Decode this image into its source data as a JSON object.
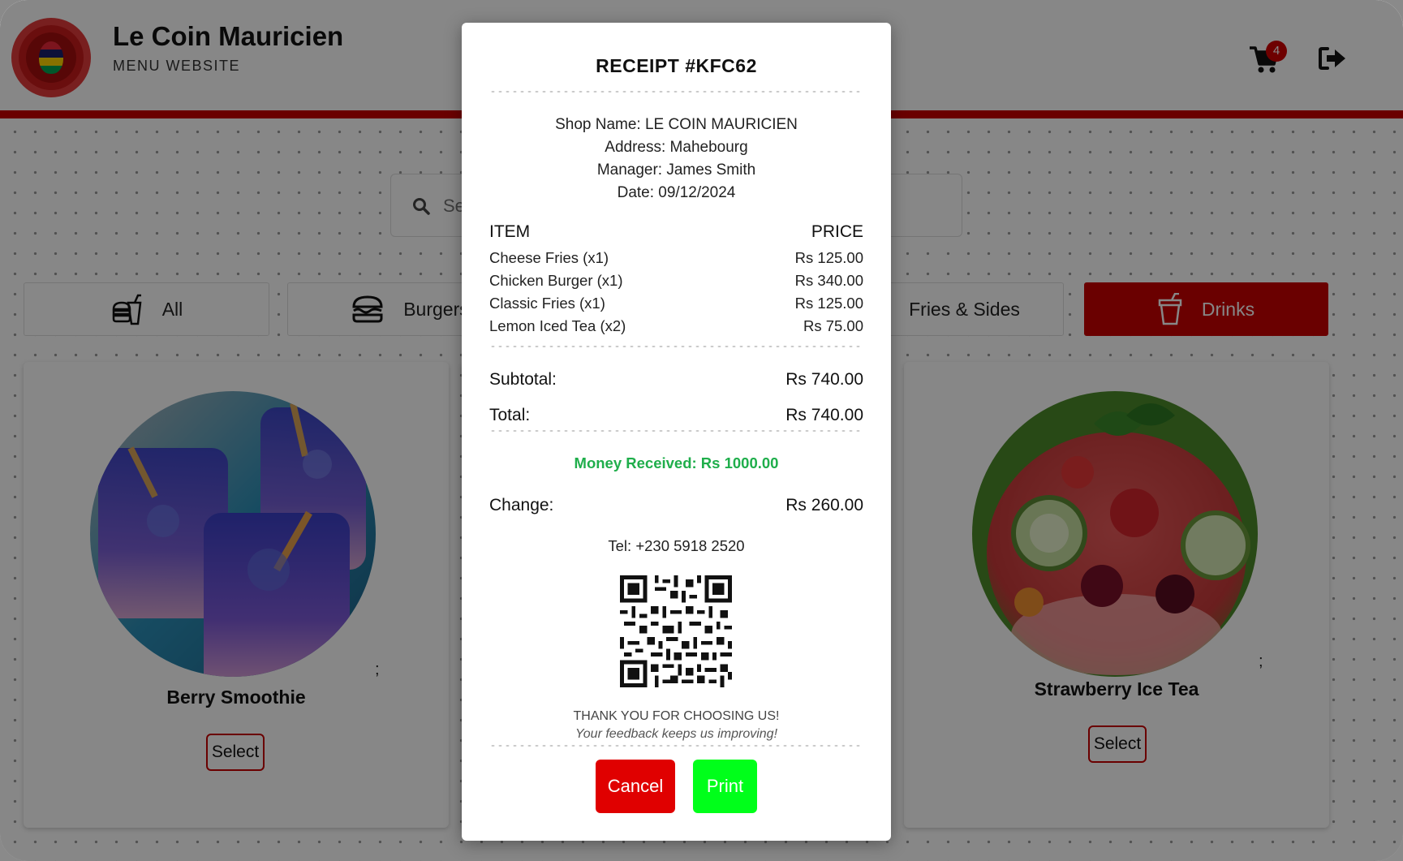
{
  "header": {
    "title": "Le Coin Mauricien",
    "subtitle": "MENU WEBSITE",
    "cart_count": "4"
  },
  "search": {
    "placeholder": "Search..."
  },
  "categories": [
    {
      "label": "All",
      "icon": "fast-food-icon",
      "active": false
    },
    {
      "label": "Burgers",
      "icon": "burger-icon",
      "active": false
    },
    {
      "label": "Fries & Sides",
      "icon": "fries-icon",
      "active": false
    },
    {
      "label": "Drinks",
      "icon": "drink-cup-icon",
      "active": true
    }
  ],
  "products": [
    {
      "name": "Berry Smoothie",
      "note": ";",
      "button": "Select"
    },
    {
      "name": "Strawberry Ice Tea",
      "note": ";",
      "button": "Select"
    }
  ],
  "receipt": {
    "title": "RECEIPT #KFC62",
    "shop_name": "Shop Name: LE COIN MAURICIEN",
    "address": "Address: Mahebourg",
    "manager": "Manager: James Smith",
    "date": "Date: 09/12/2024",
    "col_item": "ITEM",
    "col_price": "PRICE",
    "items": [
      {
        "name": "Cheese Fries (x1)",
        "price": "Rs 125.00"
      },
      {
        "name": "Chicken Burger (x1)",
        "price": "Rs 340.00"
      },
      {
        "name": "Classic Fries (x1)",
        "price": "Rs 125.00"
      },
      {
        "name": "Lemon Iced Tea (x2)",
        "price": "Rs 75.00"
      }
    ],
    "subtotal_label": "Subtotal:",
    "subtotal_value": "Rs 740.00",
    "total_label": "Total:",
    "total_value": "Rs 740.00",
    "money_received": "Money Received: Rs 1000.00",
    "change_label": "Change:",
    "change_value": "Rs 260.00",
    "tel": "Tel: +230 5918 2520",
    "thanks": "THANK YOU FOR CHOOSING US!",
    "feedback": "Your feedback keeps us improving!",
    "cancel_label": "Cancel",
    "print_label": "Print",
    "accent_green": "#1fae4b",
    "cancel_color": "#e00000",
    "print_color": "#00ff1a"
  },
  "brand_color": "#c80000"
}
